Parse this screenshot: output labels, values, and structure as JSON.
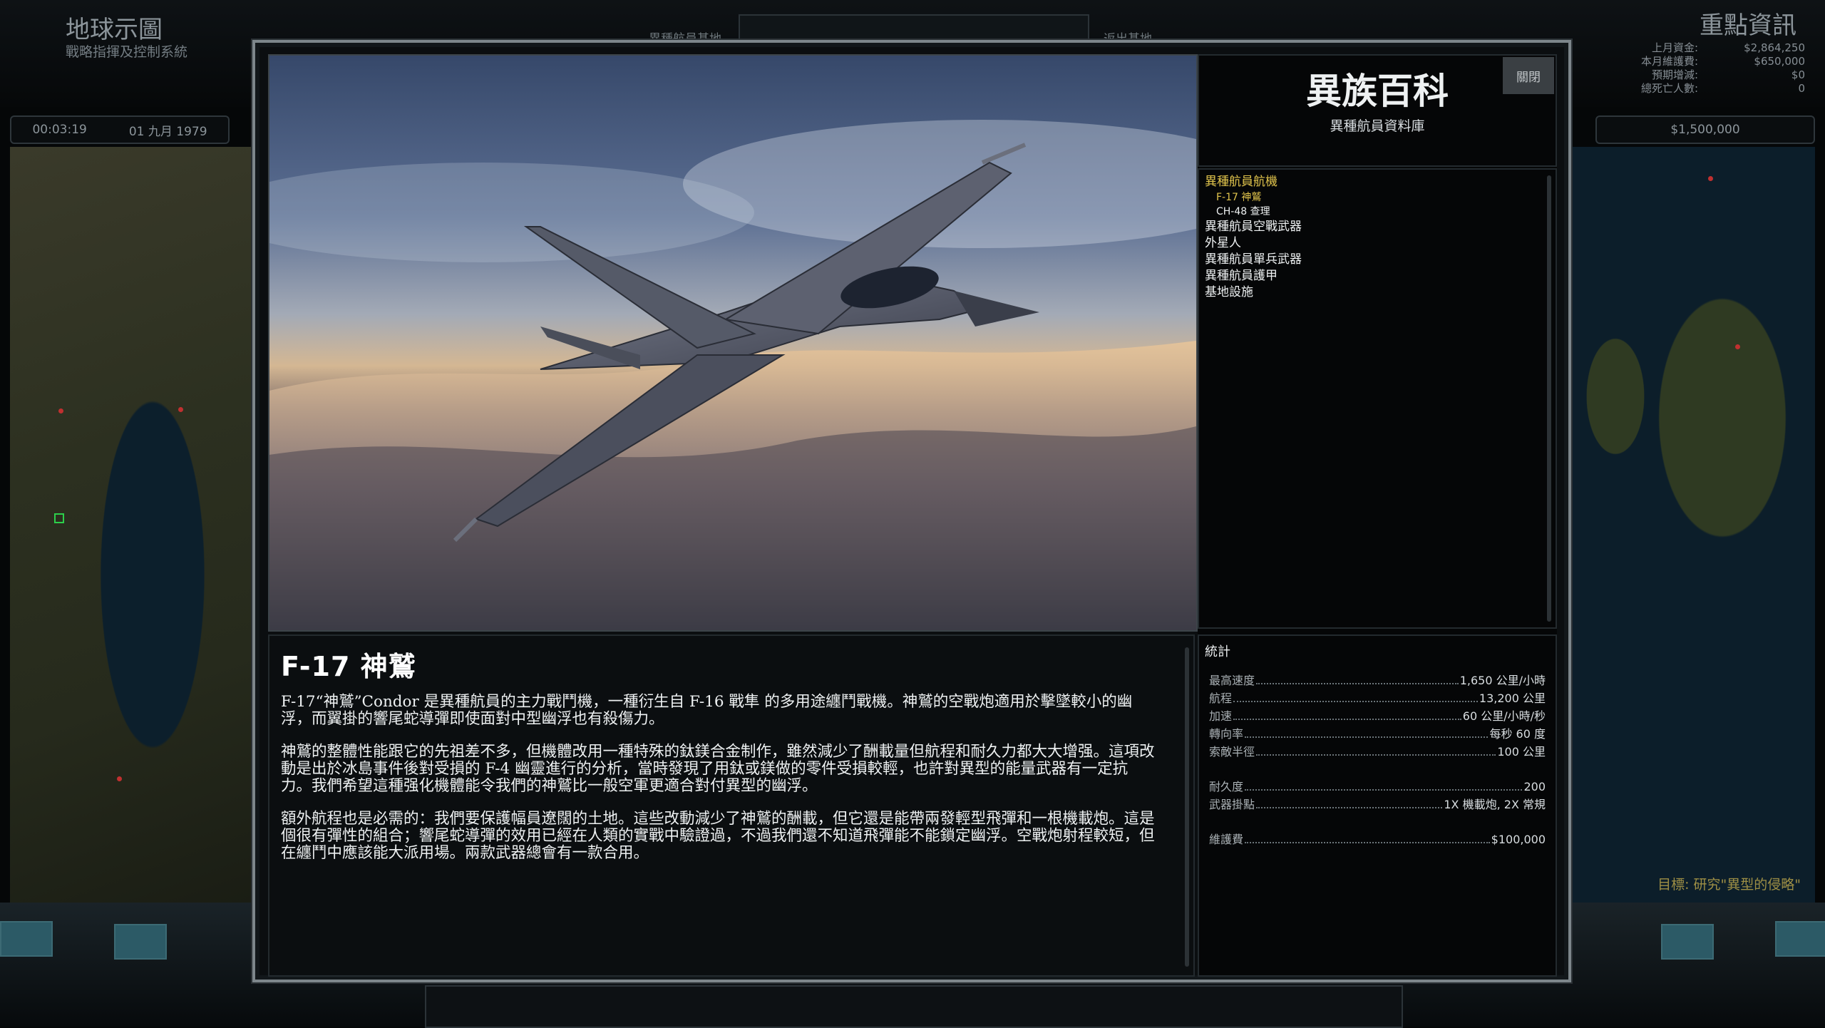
{
  "background": {
    "title": "地球示圖",
    "subtitle": "戰略指揮及控制系統",
    "right_title": "重點資訊",
    "center_labels": [
      "異種航員基地",
      "返出基地"
    ],
    "time": "00:03:19",
    "date": "01 九月 1979",
    "funds": "$1,500,000",
    "finance": [
      {
        "label": "上月資金:",
        "value": "$2,864,250"
      },
      {
        "label": "本月維護費:",
        "value": "$650,000"
      },
      {
        "label": "預期增減:",
        "value": "$0"
      },
      {
        "label": "總死亡人數:",
        "value": "0"
      }
    ],
    "objective": "目標: 研究\"異型的侵略\""
  },
  "modal": {
    "title": "異族百科",
    "subtitle": "異種航員資料庫",
    "close_label": "關閉",
    "tree": [
      {
        "label": "異種航員航機",
        "active": true,
        "children": [
          {
            "label": "F-17 神鷲",
            "active": true
          },
          {
            "label": "CH-48 查理",
            "active": false
          }
        ]
      },
      {
        "label": "異種航員空戰武器",
        "active": false
      },
      {
        "label": "外星人",
        "active": false
      },
      {
        "label": "異種航員單兵武器",
        "active": false
      },
      {
        "label": "異種航員護甲",
        "active": false
      },
      {
        "label": "基地設施",
        "active": false
      }
    ],
    "craft_name": "F-17 神鷲",
    "paragraphs": [
      "F-17“神鷲”Condor 是異種航員的主力戰鬥機，一種衍生自 F-16 戰隼 的多用途纏鬥戰機。神鷲的空戰炮適用於擊墜較小的幽浮，而翼掛的響尾蛇導彈即使面對中型幽浮也有殺傷力。",
      "神鷲的整體性能跟它的先祖差不多，但機體改用一種特殊的鈦鎂合金制作，雖然減少了酬載量但航程和耐久力都大大增强。這項改動是出於冰島事件後對受損的 F-4 幽靈進行的分析，當時發現了用鈦或鎂做的零件受損較輕，也許對異型的能量武器有一定抗力。我們希望這種强化機體能令我們的神鷲比一般空軍更適合對付異型的幽浮。",
      "額外航程也是必需的：我們要保護幅員遼闊的土地。這些改動減少了神鷲的酬載，但它還是能帶兩發輕型飛彈和一根機載炮。這是個很有彈性的組合；響尾蛇導彈的效用已經在人類的實戰中驗證過，不過我們還不知道飛彈能不能鎖定幽浮。空戰炮射程較短，但在纏鬥中應該能大派用場。兩款武器總會有一款合用。"
    ],
    "stats_heading": "統計",
    "stats": [
      {
        "label": "最高速度",
        "value": "1,650 公里/小時"
      },
      {
        "label": "航程",
        "value": "13,200 公里"
      },
      {
        "label": "加速",
        "value": "60 公里/小時/秒"
      },
      {
        "label": "轉向率",
        "value": "每秒 60 度"
      },
      {
        "label": "索敵半徑",
        "value": "100 公里"
      },
      {
        "label": "耐久度",
        "value": "200"
      },
      {
        "label": "武器掛點",
        "value": "1X 機載炮, 2X 常規"
      },
      {
        "label": "維護費",
        "value": "$100,000"
      }
    ]
  }
}
